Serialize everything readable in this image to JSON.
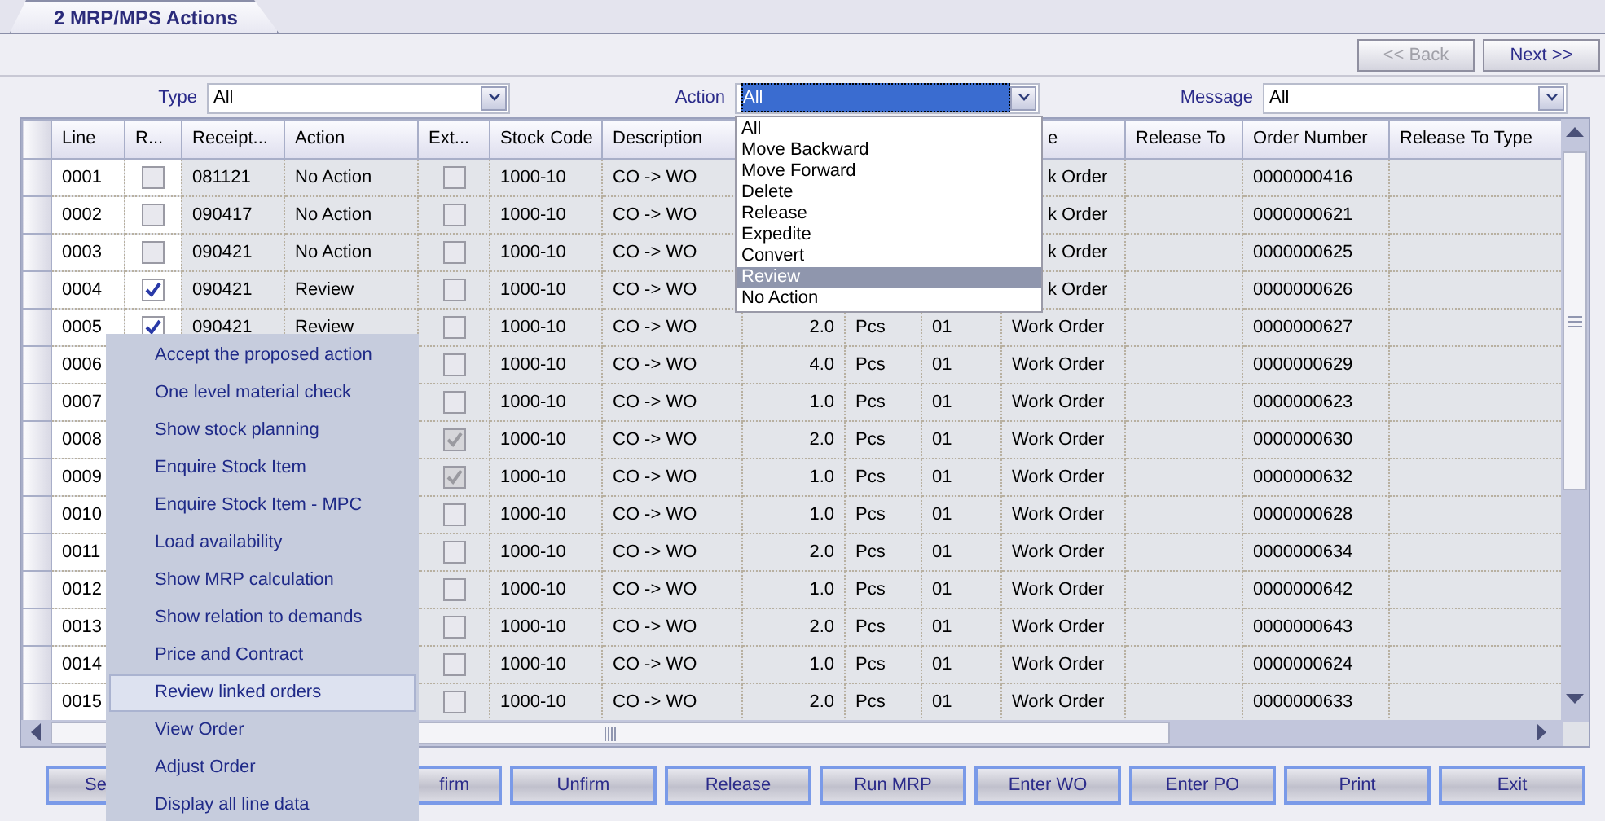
{
  "tab": {
    "label": "2 MRP/MPS Actions",
    "selected": true
  },
  "nav_buttons": [
    {
      "label": "<< Back",
      "disabled": true
    },
    {
      "label": "Next >>",
      "disabled": false
    }
  ],
  "filters": [
    {
      "label": "Type",
      "value": "All",
      "focused": false
    },
    {
      "label": "Action",
      "value": "All",
      "focused": true
    },
    {
      "label": "Message",
      "value": "All",
      "focused": false
    }
  ],
  "action_dropdown": {
    "options": [
      {
        "label": "All",
        "selected": false
      },
      {
        "label": "Move Backward",
        "selected": false
      },
      {
        "label": "Move Forward",
        "selected": false
      },
      {
        "label": "Delete",
        "selected": false
      },
      {
        "label": "Release",
        "selected": false
      },
      {
        "label": "Expedite",
        "selected": false
      },
      {
        "label": "Convert",
        "selected": false
      },
      {
        "label": "Review",
        "selected": true
      },
      {
        "label": "No Action",
        "selected": false
      }
    ]
  },
  "table": {
    "columns": [
      {
        "label": "Line",
        "kind": "text"
      },
      {
        "label": "R...",
        "kind": "check",
        "disabled": false
      },
      {
        "label": "Receipt...",
        "kind": "text"
      },
      {
        "label": "Action",
        "kind": "text"
      },
      {
        "label": "Ext...",
        "kind": "check",
        "disabled": true
      },
      {
        "label": "Stock Code",
        "kind": "text"
      },
      {
        "label": "Description",
        "kind": "text"
      },
      {
        "kind": "number"
      },
      {
        "kind": "text"
      },
      {
        "kind": "text"
      },
      {
        "label": "e",
        "kind": "text"
      },
      {
        "label": "Release To",
        "kind": "text"
      },
      {
        "label": "Order Number",
        "kind": "text"
      },
      {
        "label": "Release To Type",
        "kind": "text"
      }
    ],
    "rows": [
      {
        "cells": [
          "0001",
          false,
          "081121",
          "No Action",
          false,
          "1000-10",
          "CO -> WO",
          null,
          null,
          null,
          "k Order",
          null,
          "0000000416",
          null
        ]
      },
      {
        "cells": [
          "0002",
          false,
          "090417",
          "No Action",
          false,
          "1000-10",
          "CO -> WO",
          null,
          null,
          null,
          "k Order",
          null,
          "0000000621",
          null
        ]
      },
      {
        "cells": [
          "0003",
          false,
          "090421",
          "No Action",
          false,
          "1000-10",
          "CO -> WO",
          null,
          null,
          null,
          "k Order",
          null,
          "0000000625",
          null
        ]
      },
      {
        "cells": [
          "0004",
          true,
          "090421",
          "Review",
          false,
          "1000-10",
          "CO -> WO",
          null,
          null,
          null,
          "k Order",
          null,
          "0000000626",
          null
        ]
      },
      {
        "cells": [
          "0005",
          true,
          "090421",
          "Review",
          false,
          "1000-10",
          "CO -> WO",
          "2.0",
          "Pcs",
          "01",
          "Work Order",
          null,
          "0000000627",
          null
        ]
      },
      {
        "cells": [
          "0006",
          null,
          null,
          null,
          false,
          "1000-10",
          "CO -> WO",
          "4.0",
          "Pcs",
          "01",
          "Work Order",
          null,
          "0000000629",
          null
        ]
      },
      {
        "cells": [
          "0007",
          null,
          null,
          null,
          false,
          "1000-10",
          "CO -> WO",
          "1.0",
          "Pcs",
          "01",
          "Work Order",
          null,
          "0000000623",
          null
        ]
      },
      {
        "cells": [
          "0008",
          null,
          null,
          null,
          true,
          "1000-10",
          "CO -> WO",
          "2.0",
          "Pcs",
          "01",
          "Work Order",
          null,
          "0000000630",
          null
        ]
      },
      {
        "cells": [
          "0009",
          null,
          null,
          null,
          true,
          "1000-10",
          "CO -> WO",
          "1.0",
          "Pcs",
          "01",
          "Work Order",
          null,
          "0000000632",
          null
        ]
      },
      {
        "cells": [
          "0010",
          null,
          null,
          null,
          false,
          "1000-10",
          "CO -> WO",
          "1.0",
          "Pcs",
          "01",
          "Work Order",
          null,
          "0000000628",
          null
        ]
      },
      {
        "cells": [
          "0011",
          null,
          null,
          null,
          false,
          "1000-10",
          "CO -> WO",
          "2.0",
          "Pcs",
          "01",
          "Work Order",
          null,
          "0000000634",
          null
        ]
      },
      {
        "cells": [
          "0012",
          null,
          null,
          null,
          false,
          "1000-10",
          "CO -> WO",
          "1.0",
          "Pcs",
          "01",
          "Work Order",
          null,
          "0000000642",
          null
        ]
      },
      {
        "cells": [
          "0013",
          null,
          null,
          null,
          false,
          "1000-10",
          "CO -> WO",
          "2.0",
          "Pcs",
          "01",
          "Work Order",
          null,
          "0000000643",
          null
        ]
      },
      {
        "cells": [
          "0014",
          null,
          null,
          null,
          false,
          "1000-10",
          "CO -> WO",
          "1.0",
          "Pcs",
          "01",
          "Work Order",
          null,
          "0000000624",
          null
        ]
      },
      {
        "cells": [
          "0015",
          null,
          null,
          null,
          false,
          "1000-10",
          "CO -> WO",
          "2.0",
          "Pcs",
          "01",
          "Work Order",
          null,
          "0000000633",
          null
        ]
      }
    ]
  },
  "context_menu": {
    "items": [
      {
        "label": "Accept the proposed action",
        "hovered": false
      },
      {
        "label": "One level material check",
        "hovered": false
      },
      {
        "label": "Show stock planning",
        "hovered": false
      },
      {
        "label": "Enquire Stock Item",
        "hovered": false
      },
      {
        "label": "Enquire Stock Item - MPC",
        "hovered": false
      },
      {
        "label": "Load availability",
        "hovered": false
      },
      {
        "label": "Show MRP calculation",
        "hovered": false
      },
      {
        "label": "Show relation to demands",
        "hovered": false
      },
      {
        "label": "Price and Contract",
        "hovered": false
      },
      {
        "label": "Review linked orders",
        "hovered": true
      },
      {
        "label": "View Order",
        "hovered": false
      },
      {
        "label": "Adjust Order",
        "hovered": false
      },
      {
        "label": "Display all line data",
        "hovered": false
      }
    ]
  },
  "buttons": [
    {
      "label": "Se",
      "covered_right": true
    },
    {
      "label": "firm",
      "covered_left": true
    },
    {
      "label": "Unfirm"
    },
    {
      "label": "Release"
    },
    {
      "label": "Run MRP"
    },
    {
      "label": "Enter WO"
    },
    {
      "label": "Enter PO"
    },
    {
      "label": "Print"
    },
    {
      "label": "Exit"
    }
  ]
}
